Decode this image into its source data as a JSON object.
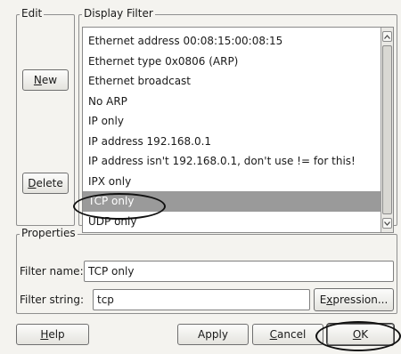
{
  "edit_group": {
    "title": "Edit",
    "new_button": {
      "mnemonic": "N",
      "rest": "ew"
    },
    "delete_button": {
      "mnemonic": "D",
      "rest": "elete"
    }
  },
  "display_filter_group": {
    "title": "Display Filter",
    "items": [
      "Ethernet address 00:08:15:00:08:15",
      "Ethernet type 0x0806 (ARP)",
      "Ethernet broadcast",
      "No ARP",
      "IP only",
      "IP address 192.168.0.1",
      "IP address isn't 192.168.0.1, don't use != for this!",
      "IPX only",
      "TCP only",
      "UDP only"
    ],
    "selected_item": "TCP only"
  },
  "properties_group": {
    "title": "Properties",
    "filter_name": {
      "label": "Filter name:",
      "value": "TCP only"
    },
    "filter_string": {
      "label": "Filter string:",
      "value": "tcp"
    },
    "expression_button": {
      "mnemonic": "x",
      "before": "E",
      "after": "pression..."
    }
  },
  "buttons": {
    "help": {
      "mnemonic": "H",
      "rest": "elp"
    },
    "apply": {
      "label": "Apply"
    },
    "cancel": {
      "mnemonic": "C",
      "rest": "ancel"
    },
    "ok": {
      "mnemonic": "O",
      "rest": "K"
    }
  },
  "icons": {
    "scroll_up": "chevron-up-icon",
    "scroll_down": "chevron-down-icon"
  },
  "colors": {
    "selection": "#9a9a9a",
    "annotation": "#111111"
  }
}
